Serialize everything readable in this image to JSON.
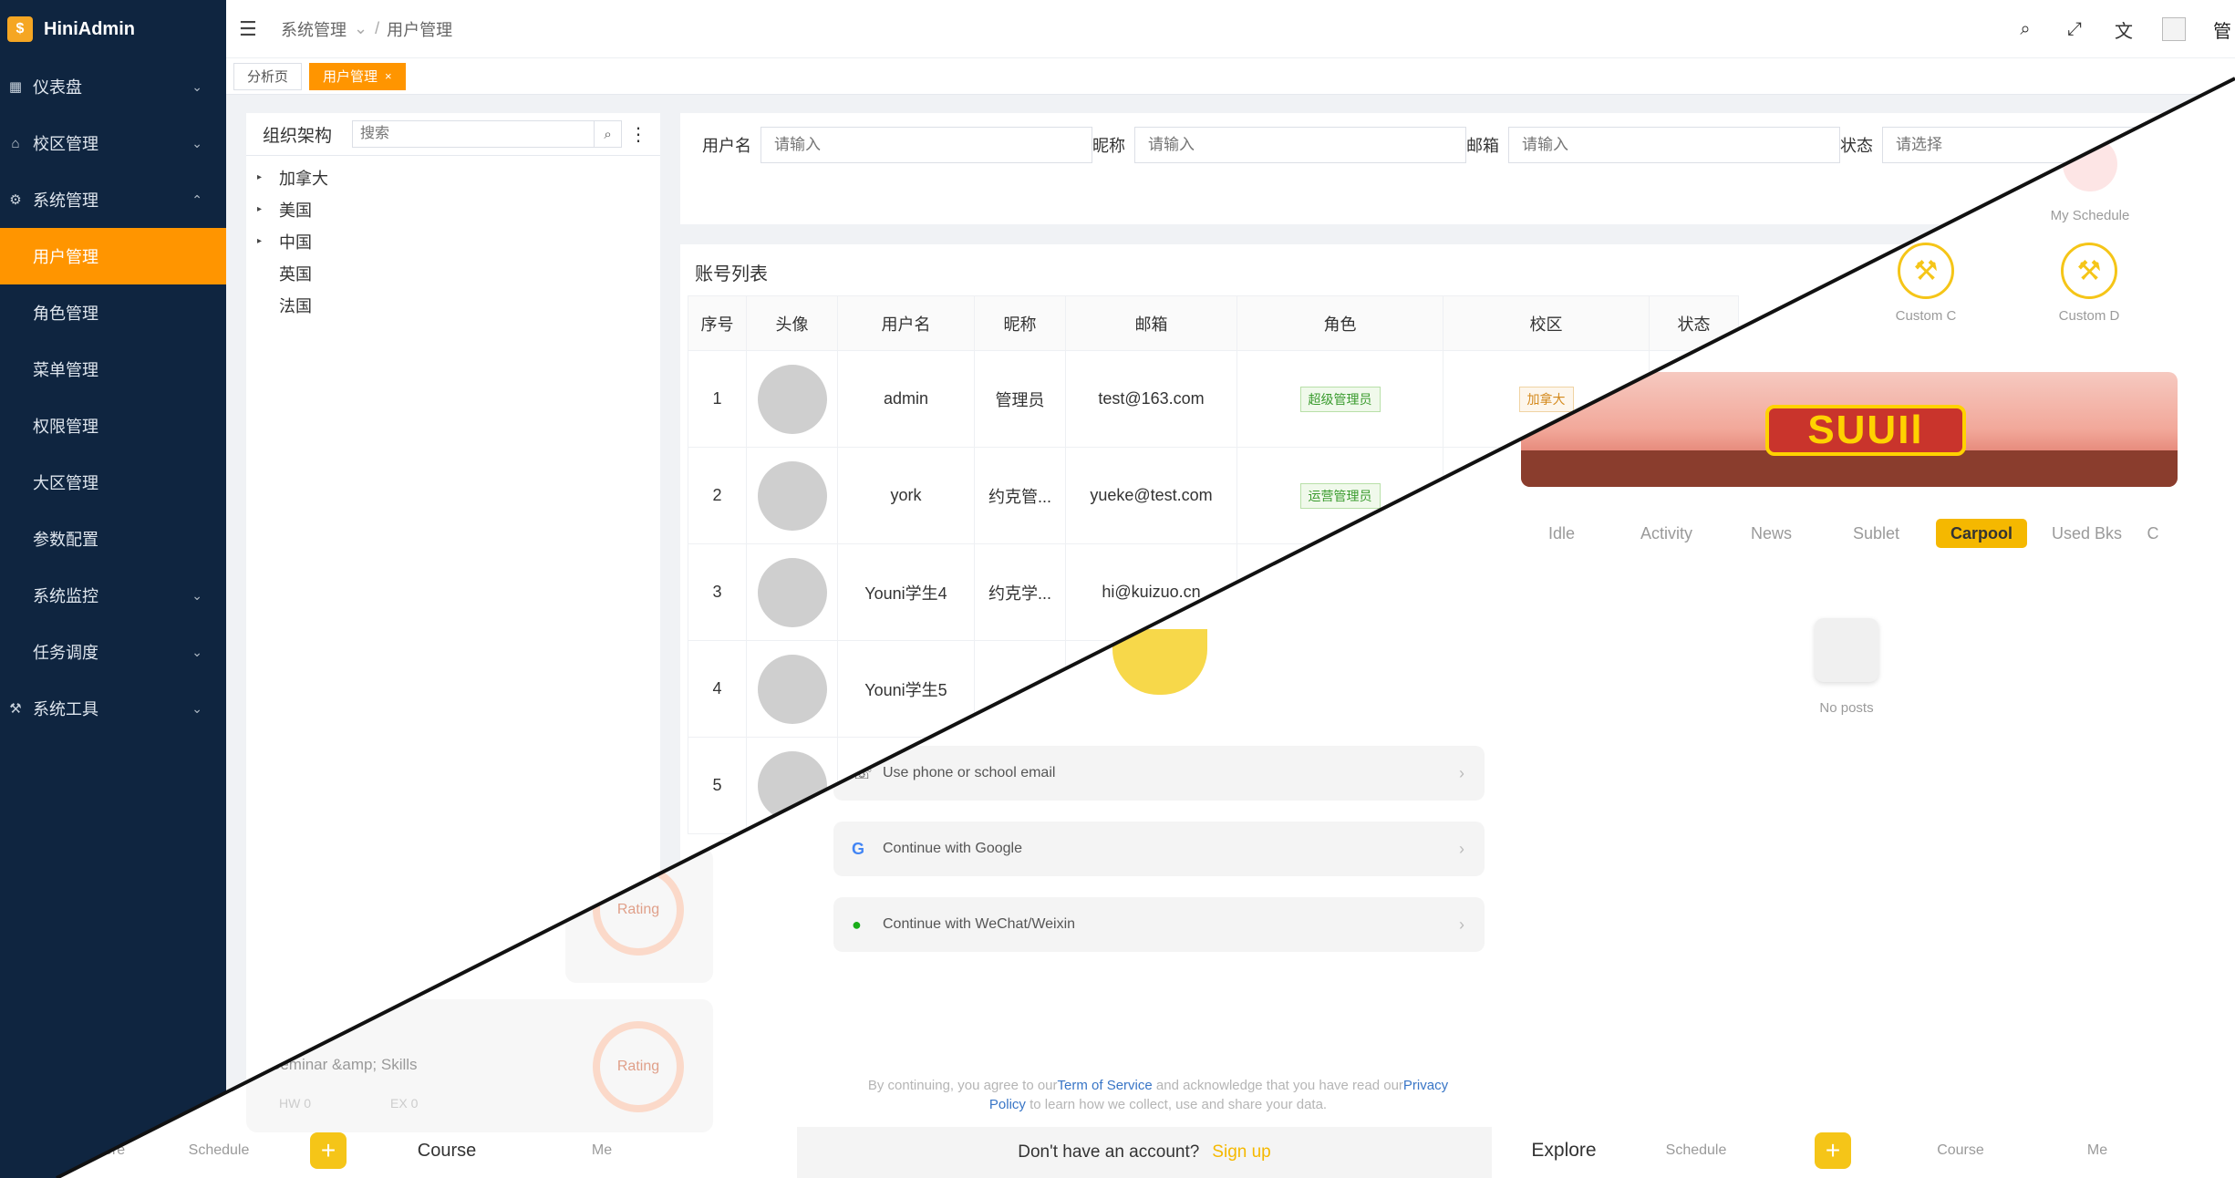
{
  "app": {
    "name": "HiniAdmin"
  },
  "sidebar": {
    "items": [
      {
        "label": "仪表盘",
        "icon": "dashboard-icon",
        "chevron": "⌄"
      },
      {
        "label": "校区管理",
        "icon": "building-icon",
        "chevron": "⌄"
      },
      {
        "label": "系统管理",
        "icon": "gear-icon",
        "chevron": "⌃"
      },
      {
        "label": "用户管理",
        "sub": true,
        "active": true
      },
      {
        "label": "角色管理",
        "sub": true
      },
      {
        "label": "菜单管理",
        "sub": true
      },
      {
        "label": "权限管理",
        "sub": true
      },
      {
        "label": "大区管理",
        "sub": true
      },
      {
        "label": "参数配置",
        "sub": true
      },
      {
        "label": "系统监控",
        "sub": true,
        "chevron": "⌄"
      },
      {
        "label": "任务调度",
        "sub": true,
        "chevron": "⌄"
      },
      {
        "label": "系统工具",
        "icon": "wrench-icon",
        "chevron": "⌄"
      }
    ]
  },
  "header": {
    "breadcrumb": [
      "系统管理",
      "用户管理"
    ],
    "user": "管"
  },
  "tabs": [
    {
      "label": "分析页"
    },
    {
      "label": "用户管理",
      "close": "×"
    }
  ],
  "tree": {
    "title": "组织架构",
    "search_placeholder": "搜索",
    "nodes": [
      {
        "label": "加拿大",
        "caret": "▸"
      },
      {
        "label": "美国",
        "caret": "▸"
      },
      {
        "label": "中国",
        "caret": "▸"
      },
      {
        "label": "英国",
        "caret": ""
      },
      {
        "label": "法国",
        "caret": ""
      }
    ]
  },
  "filters": {
    "username": {
      "label": "用户名",
      "placeholder": "请输入"
    },
    "nickname": {
      "label": "昵称",
      "placeholder": "请输入"
    },
    "email": {
      "label": "邮箱",
      "placeholder": "请输入"
    },
    "status": {
      "label": "状态",
      "placeholder": "请选择"
    }
  },
  "table": {
    "title": "账号列表",
    "columns": [
      "序号",
      "头像",
      "用户名",
      "昵称",
      "邮箱",
      "角色",
      "校区",
      "状态"
    ],
    "rows": [
      {
        "no": "1",
        "username": "admin",
        "nickname": "管理员",
        "email": "test@163.com",
        "role": "超级管理员",
        "campus": "加拿大"
      },
      {
        "no": "2",
        "username": "york",
        "nickname": "约克管...",
        "email": "yueke@test.com",
        "role": "运营管理员",
        "campus": ""
      },
      {
        "no": "3",
        "username": "Youni学生4",
        "nickname": "约克学...",
        "email": "hi@kuizuo.cn",
        "role": "",
        "campus": ""
      },
      {
        "no": "4",
        "username": "Youni学生5",
        "nickname": "",
        "email": "",
        "role": "",
        "campus": ""
      },
      {
        "no": "5",
        "username": "",
        "nickname": "",
        "email": "",
        "role": "",
        "campus": ""
      }
    ]
  },
  "overlay": {
    "my_schedule": "My Schedule",
    "custom_c": "Custom C",
    "custom_d": "Custom D",
    "banner_text": "SUUIl",
    "categories": [
      "Idle",
      "Activity",
      "News",
      "Sublet",
      "Carpool",
      "Used Bks",
      "C"
    ],
    "active_category": "Carpool",
    "no_posts": "No posts",
    "login_phone": "Use phone or school email",
    "login_google": "Continue with Google",
    "login_wechat": "Continue with WeChat/Weixin",
    "legal_prefix": "By continuing, you agree to our",
    "legal_tos": "Term of Service",
    "legal_mid": " and acknowledge that you have read our",
    "legal_privacy_1": "Privacy",
    "legal_privacy_2": "Policy",
    "legal_suffix": " to learn how we collect, use and share your data.",
    "no_account": "Don't have an account?",
    "sign_up": "Sign up",
    "rating": "Rating",
    "course_name": "Seminar &amp; Skills",
    "hw": "HW 0",
    "ex": "EX 0",
    "nav_left": [
      "Explore",
      "Schedule",
      "+",
      "Course",
      "Me"
    ],
    "nav_right": [
      "Explore",
      "Schedule",
      "+",
      "Course",
      "Me"
    ]
  }
}
